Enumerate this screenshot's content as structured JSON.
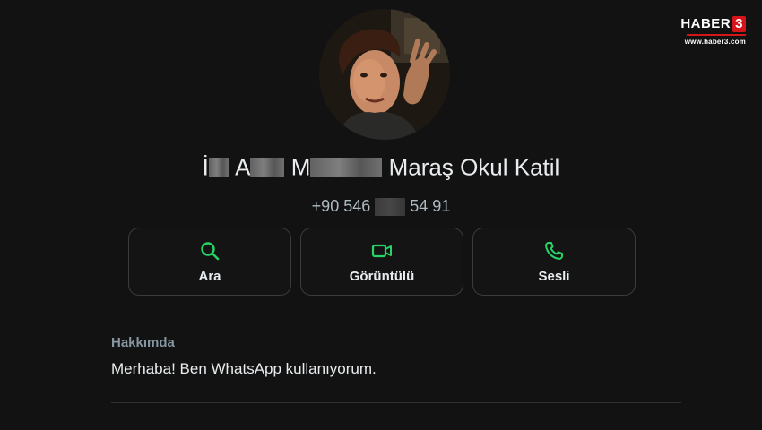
{
  "watermark": {
    "brand": "HABER",
    "number": "3",
    "url": "www.haber3.com"
  },
  "contact": {
    "name_parts": [
      "İ",
      "A",
      "M",
      "Maraş Okul Katil"
    ],
    "phone_parts": [
      "+90 546",
      "54 91"
    ]
  },
  "actions": [
    {
      "label": "Ara",
      "icon": "search-icon"
    },
    {
      "label": "Görüntülü",
      "icon": "video-icon"
    },
    {
      "label": "Sesli",
      "icon": "phone-icon"
    }
  ],
  "about": {
    "title": "Hakkımda",
    "text": "Merhaba! Ben WhatsApp kullanıyorum."
  },
  "colors": {
    "accent": "#25d366",
    "background": "#121212",
    "watermark_red": "#d6151b"
  }
}
